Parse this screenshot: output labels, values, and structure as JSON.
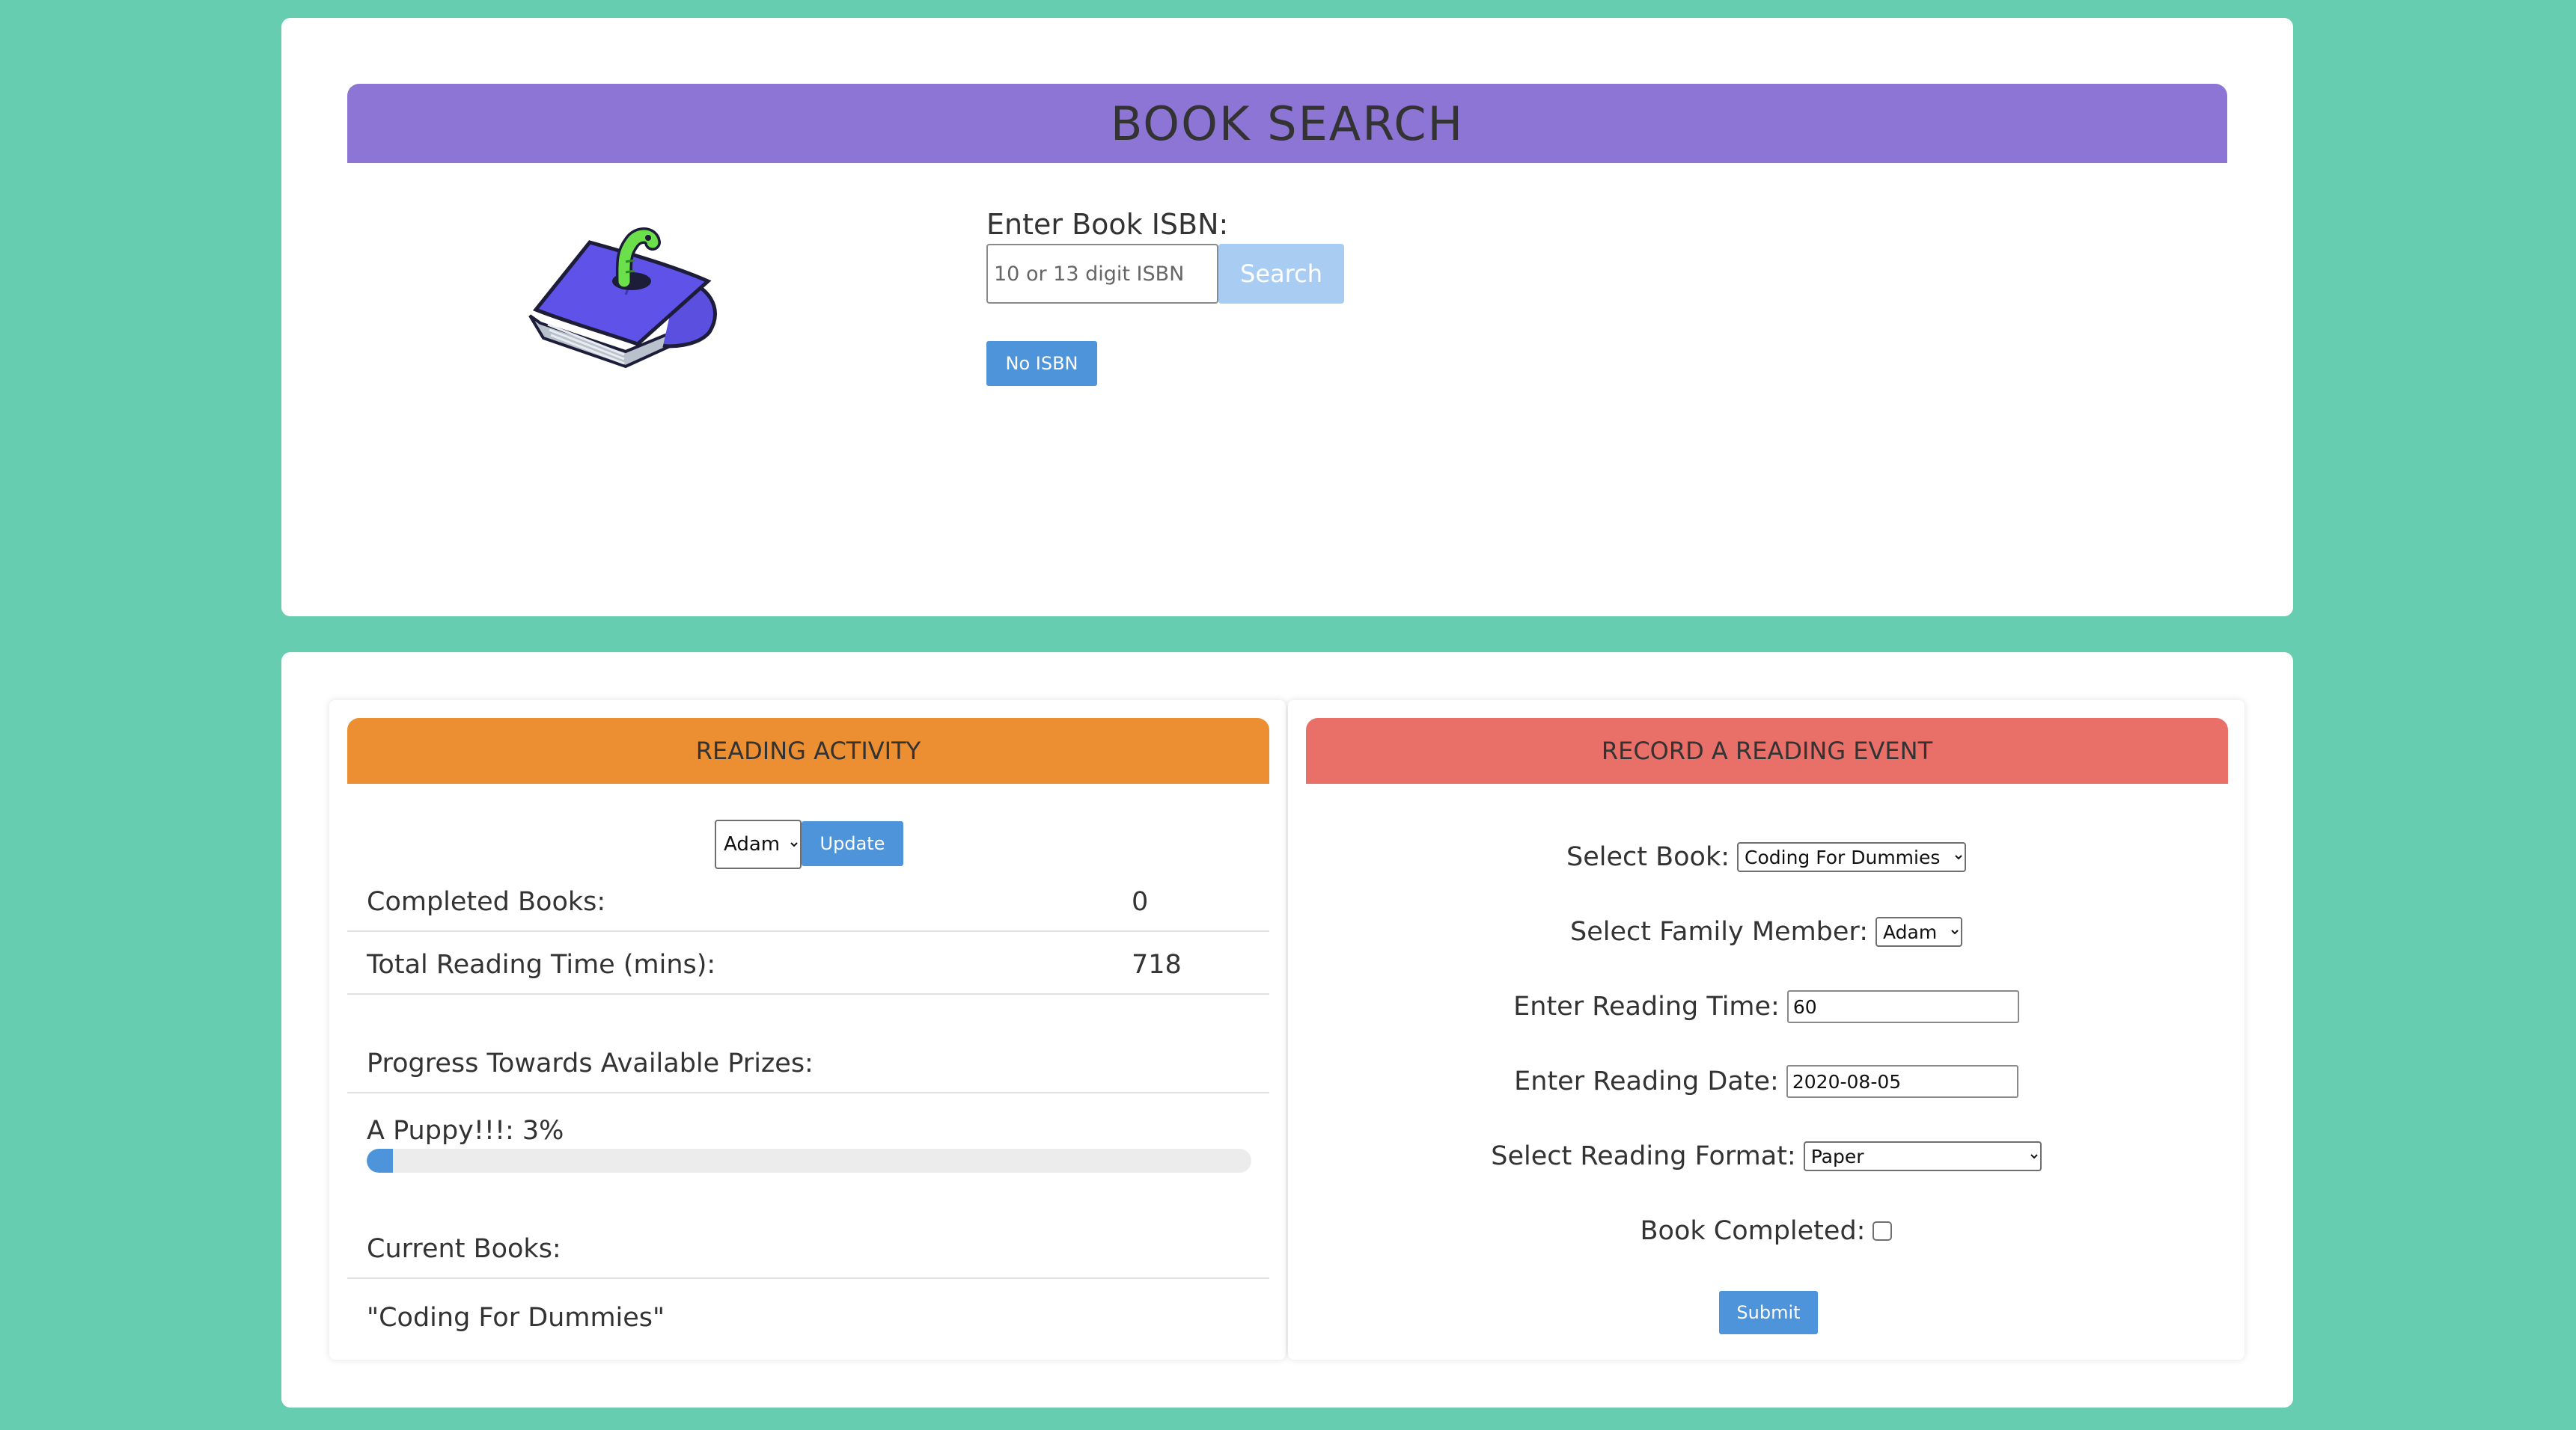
{
  "search_card": {
    "title": "BOOK SEARCH",
    "logo_icon": "book-with-worm-icon",
    "isbn_label": "Enter Book ISBN:",
    "isbn_placeholder": "10 or 13 digit ISBN",
    "isbn_value": "",
    "search_label": "Search",
    "no_isbn_label": "No ISBN"
  },
  "reading_activity": {
    "title": "READING ACTIVITY",
    "member_selected": "Adam",
    "update_label": "Update",
    "completed_books_label": "Completed Books:",
    "completed_books_value": "0",
    "total_time_label": "Total Reading Time (mins):",
    "total_time_value": "718",
    "progress_heading": "Progress Towards Available Prizes:",
    "prizes": [
      {
        "label": "A Puppy!!!: 3%",
        "percent": 3
      }
    ],
    "current_books_heading": "Current Books:",
    "current_books": [
      "\"Coding For Dummies\""
    ]
  },
  "record_event": {
    "title": "RECORD A READING EVENT",
    "select_book_label": "Select Book:",
    "select_book_value": "Coding For Dummies",
    "select_member_label": "Select Family Member:",
    "select_member_value": "Adam",
    "reading_time_label": "Enter Reading Time:",
    "reading_time_value": "60",
    "reading_date_label": "Enter Reading Date:",
    "reading_date_value": "2020-08-05",
    "format_label": "Select Reading Format:",
    "format_value": "Paper",
    "completed_label": "Book Completed:",
    "completed_checked": false,
    "submit_label": "Submit"
  },
  "colors": {
    "page_background": "#66cdb1",
    "search_banner": "#8d75d5",
    "activity_header": "#ec8f32",
    "record_header": "#e96f69",
    "primary_button": "#4e94da",
    "disabled_button": "#a9cdf2"
  }
}
